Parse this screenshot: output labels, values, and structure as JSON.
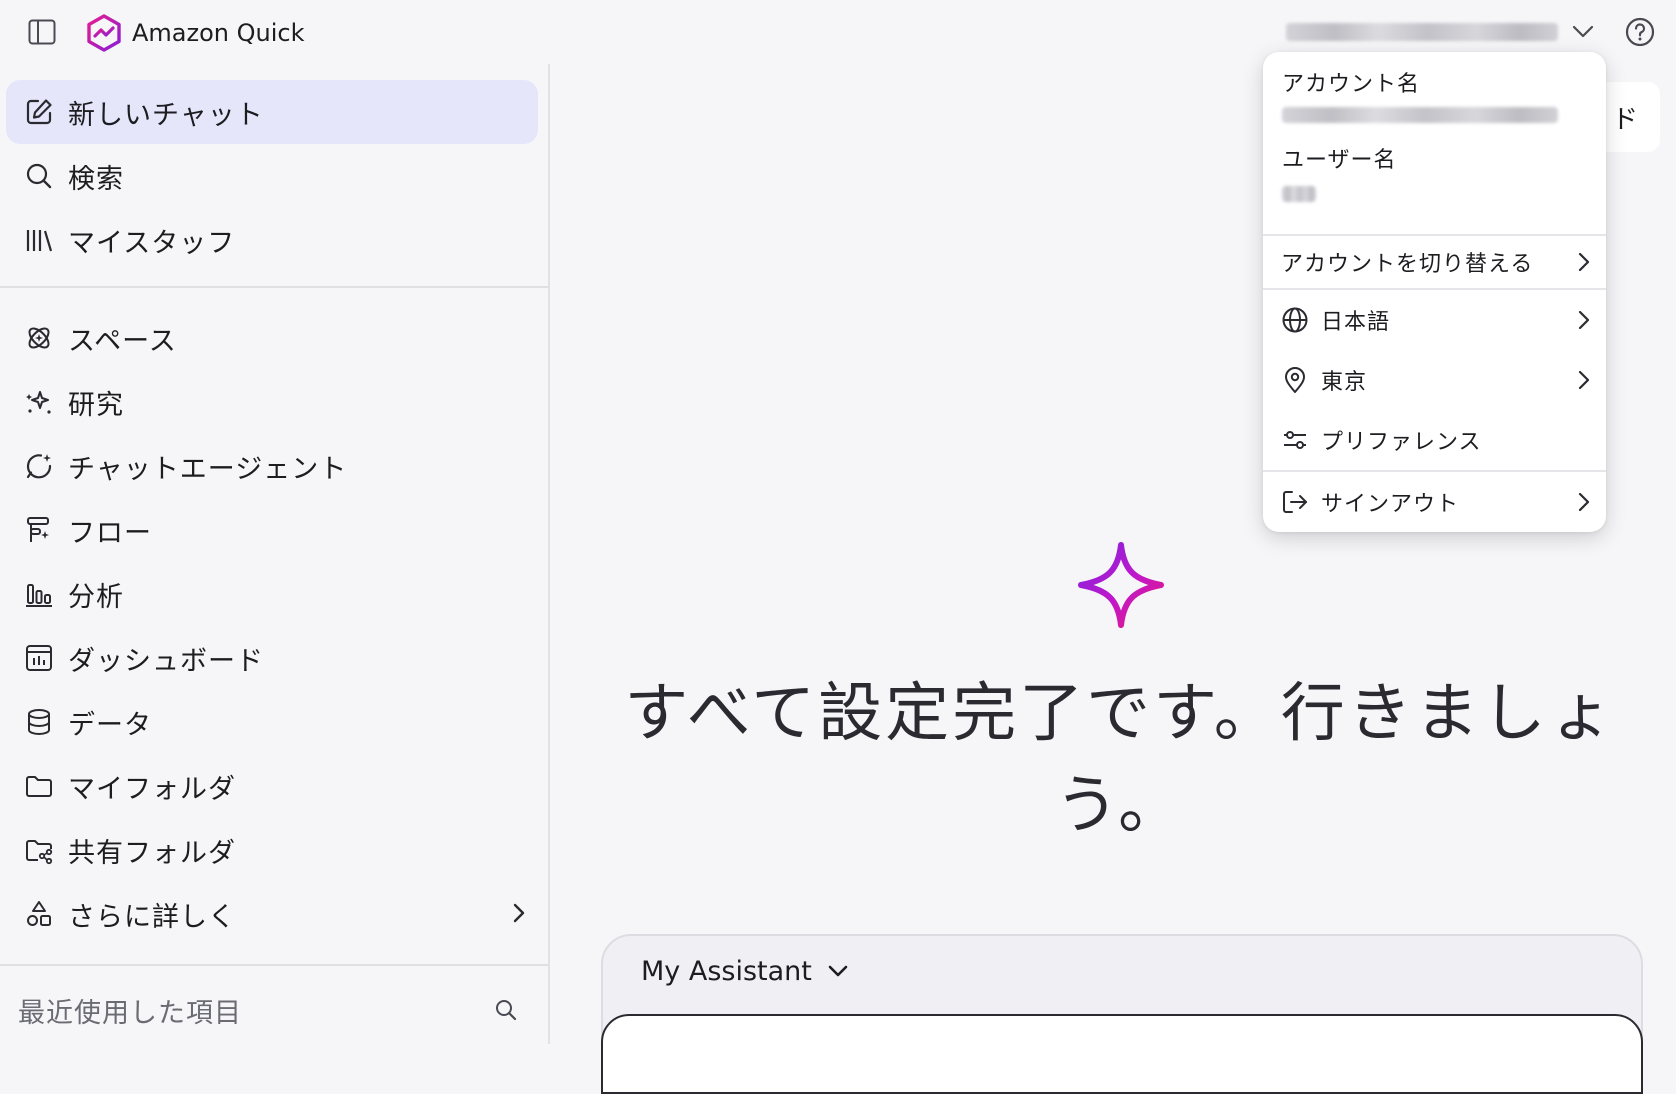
{
  "app": {
    "name": "Amazon Quick"
  },
  "sidebar": {
    "items": [
      {
        "label": "新しいチャット",
        "icon": "edit-icon"
      },
      {
        "label": "検索",
        "icon": "search-icon"
      },
      {
        "label": "マイスタッフ",
        "icon": "library-icon"
      },
      {
        "label": "スペース",
        "icon": "spaces-icon"
      },
      {
        "label": "研究",
        "icon": "research-icon"
      },
      {
        "label": "チャットエージェント",
        "icon": "chat-agent-icon"
      },
      {
        "label": "フロー",
        "icon": "flow-icon"
      },
      {
        "label": "分析",
        "icon": "analysis-icon"
      },
      {
        "label": "ダッシュボード",
        "icon": "dashboard-icon"
      },
      {
        "label": "データ",
        "icon": "database-icon"
      },
      {
        "label": "マイフォルダ",
        "icon": "folder-icon"
      },
      {
        "label": "共有フォルダ",
        "icon": "shared-folder-icon"
      },
      {
        "label": "さらに詳しく",
        "icon": "shapes-icon"
      }
    ],
    "recent_label": "最近使用した項目"
  },
  "main": {
    "headline": "すべて設定完了です。行きましょう。",
    "behind_text": "ド",
    "assistant_label": "My Assistant"
  },
  "account_menu": {
    "account_name_label": "アカウント名",
    "user_name_label": "ユーザー名",
    "switch_account": "アカウントを切り替える",
    "language": "日本語",
    "region": "東京",
    "preferences": "プリファレンス",
    "sign_out": "サインアウト"
  },
  "colors": {
    "accent": "#c118c9",
    "active_bg": "#e6e6fb",
    "sparkle_start": "#7d24e0",
    "sparkle_end": "#e8197a"
  }
}
